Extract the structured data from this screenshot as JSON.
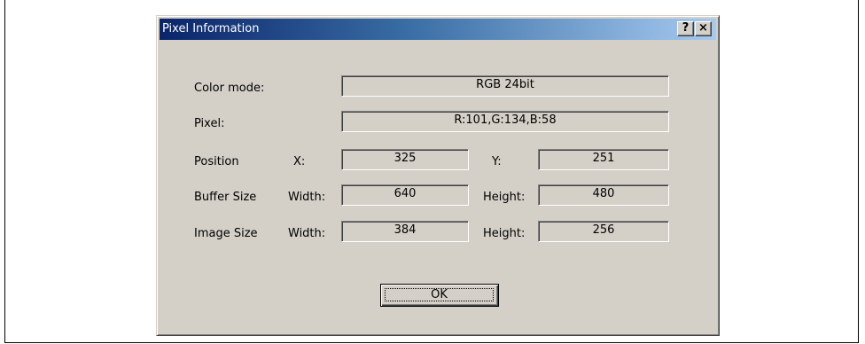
{
  "dialog": {
    "title": "Pixel Information",
    "help_button": "?",
    "close_button": "×"
  },
  "color_mode": {
    "label": "Color mode:",
    "value": "RGB 24bit"
  },
  "pixel": {
    "label": "Pixel:",
    "value": "R:101,G:134,B:58"
  },
  "position": {
    "label": "Position",
    "x_label": "X:",
    "x_value": "325",
    "y_label": "Y:",
    "y_value": "251"
  },
  "buffer_size": {
    "label": "Buffer Size",
    "width_label": "Width:",
    "width_value": "640",
    "height_label": "Height:",
    "height_value": "480"
  },
  "image_size": {
    "label": "Image Size",
    "width_label": "Width:",
    "width_value": "384",
    "height_label": "Height:",
    "height_value": "256"
  },
  "buttons": {
    "ok": "OK"
  }
}
